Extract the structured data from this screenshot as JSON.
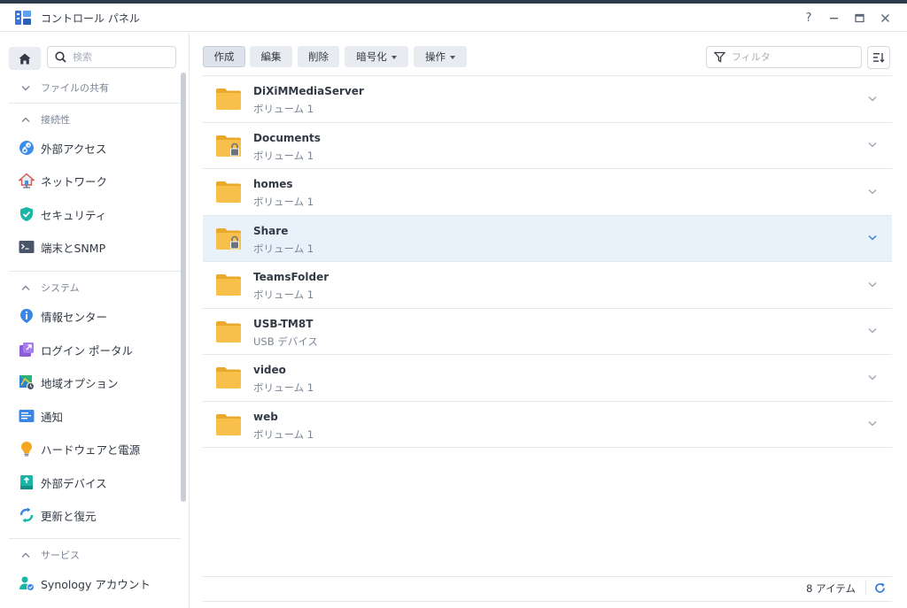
{
  "window": {
    "title": "コントロール パネル",
    "controls": {
      "help": "?"
    }
  },
  "sidebar": {
    "search_placeholder": "検索",
    "sections": [
      {
        "label": "ファイルの共有",
        "items": []
      },
      {
        "label": "接続性",
        "items": [
          {
            "label": "外部アクセス",
            "icon": "external-access-icon"
          },
          {
            "label": "ネットワーク",
            "icon": "network-house-icon"
          },
          {
            "label": "セキュリティ",
            "icon": "security-shield-icon"
          },
          {
            "label": "端末とSNMP",
            "icon": "terminal-icon"
          }
        ]
      },
      {
        "label": "システム",
        "items": [
          {
            "label": "情報センター",
            "icon": "info-center-icon"
          },
          {
            "label": "ログイン ポータル",
            "icon": "login-portal-icon"
          },
          {
            "label": "地域オプション",
            "icon": "regional-options-icon"
          },
          {
            "label": "通知",
            "icon": "notification-icon"
          },
          {
            "label": "ハードウェアと電源",
            "icon": "hardware-power-icon"
          },
          {
            "label": "外部デバイス",
            "icon": "external-devices-icon"
          },
          {
            "label": "更新と復元",
            "icon": "update-restore-icon"
          }
        ]
      },
      {
        "label": "サービス",
        "items": [
          {
            "label": "Synology アカウント",
            "icon": "synology-account-icon"
          }
        ]
      }
    ]
  },
  "toolbar": {
    "create": "作成",
    "edit": "編集",
    "delete": "削除",
    "encrypt": "暗号化",
    "action": "操作",
    "filter_placeholder": "フィルタ"
  },
  "folders": [
    {
      "name": "DiXiMMediaServer",
      "location": "ボリューム 1",
      "locked": false,
      "selected": false
    },
    {
      "name": "Documents",
      "location": "ボリューム 1",
      "locked": true,
      "selected": false
    },
    {
      "name": "homes",
      "location": "ボリューム 1",
      "locked": false,
      "selected": false
    },
    {
      "name": "Share",
      "location": "ボリューム 1",
      "locked": true,
      "selected": true
    },
    {
      "name": "TeamsFolder",
      "location": "ボリューム 1",
      "locked": false,
      "selected": false
    },
    {
      "name": "USB-TM8T",
      "location": "USB デバイス",
      "locked": false,
      "selected": false
    },
    {
      "name": "video",
      "location": "ボリューム 1",
      "locked": false,
      "selected": false
    },
    {
      "name": "web",
      "location": "ボリューム 1",
      "locked": false,
      "selected": false
    }
  ],
  "footer": {
    "item_count": "8 アイテム"
  },
  "colors": {
    "folder": "#f7c04a",
    "folder_back": "#e9a92b",
    "accent": "#2b7ad9",
    "selected_row": "#e9f1fb"
  }
}
